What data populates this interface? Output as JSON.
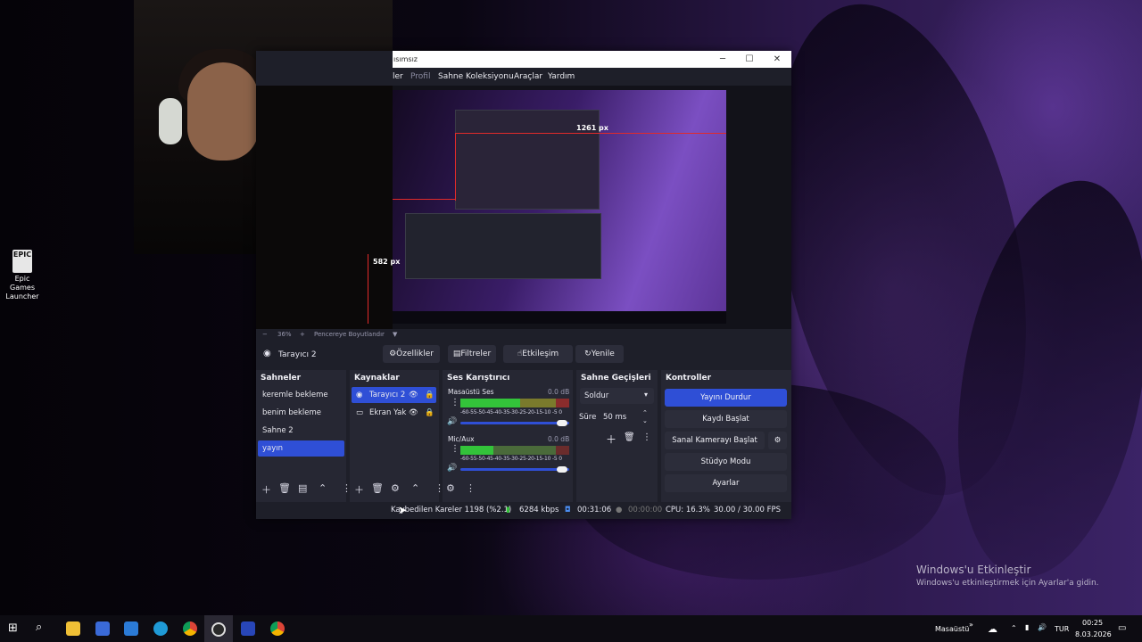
{
  "desktop": {
    "icon_label_line1": "Epic Games",
    "icon_label_line2": "Launcher",
    "icon_logo_text": "EPIC",
    "activation_title": "Windows'u Etkinleştir",
    "activation_subtitle": "Windows'u etkinleştirmek için Ayarlar'a gidin."
  },
  "obs": {
    "window_title": "ısımsız",
    "menu": [
      "ler",
      "Profil",
      "Sahne Koleksiyonu",
      "Araçlar",
      "Yardım"
    ],
    "preview": {
      "width_label": "1261 px",
      "height_label": "582 px",
      "zoom_minus": "−",
      "zoom_value": "36%",
      "zoom_plus": "+",
      "zoom_mode": "Pencereye Boyutlandır"
    },
    "source_toolbar": {
      "source_name": "Tarayıcı 2",
      "properties": "Özellikler",
      "filters": "Filtreler",
      "interact": "Etkileşim",
      "refresh": "Yenile"
    },
    "scenes": {
      "title": "Sahneler",
      "items": [
        "keremle bekleme",
        "benim bekleme",
        "Sahne 2",
        "yayın"
      ],
      "selected_index": 3
    },
    "sources": {
      "title": "Kaynaklar",
      "items": [
        "Tarayıcı 2",
        "Ekran Yak"
      ]
    },
    "mixer": {
      "title": "Ses Karıştırıcı",
      "channels": [
        {
          "name": "Masaüstü Ses",
          "db": "0.0 dB",
          "level": 0.55
        },
        {
          "name": "Mic/Aux",
          "db": "0.0 dB",
          "level": 0.3
        }
      ],
      "scale": "-60-55-50-45-40-35-30-25-20-15-10 -5 0"
    },
    "transitions": {
      "title": "Sahne Geçişleri",
      "type": "Soldur",
      "duration_label": "Süre",
      "duration_value": "50 ms"
    },
    "controls": {
      "title": "Kontroller",
      "stop_stream": "Yayını Durdur",
      "start_recording": "Kaydı Başlat",
      "virtual_camera": "Sanal Kamerayı Başlat",
      "studio_mode": "Stüdyo Modu",
      "settings": "Ayarlar"
    },
    "status": {
      "dropped_frames": "Kaybedilen Kareler 1198 (%2.1)",
      "bitrate": "6284 kbps",
      "stream_time": "00:31:06",
      "record_time": "00:00:00",
      "cpu": "CPU: 16.3%",
      "fps": "30.00 / 30.00 FPS"
    }
  },
  "taskbar": {
    "tray_desktop": "Masaüstü",
    "language": "TUR",
    "time": "00:25",
    "date": "8.03.2026"
  },
  "colors": {
    "accent": "#2f4fd6",
    "obs_bg": "#1e1f29",
    "dock_bg": "#262733",
    "meter_green": "#33c33a",
    "meter_yellow": "#c6c23a",
    "meter_red": "#d23a3a"
  }
}
